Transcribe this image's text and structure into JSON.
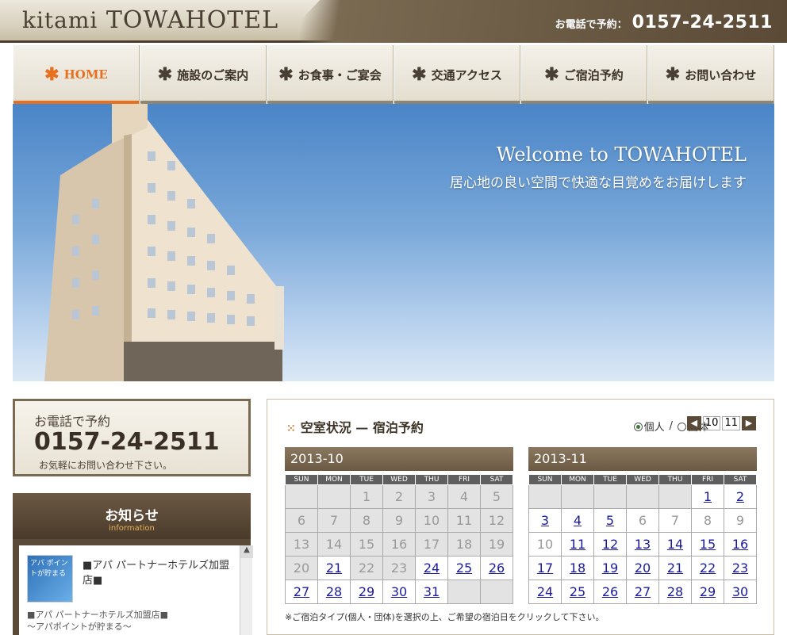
{
  "header": {
    "logo_small": "kitami",
    "logo_big": "TOWAHOTEL",
    "tel_label": "お電話で予約：",
    "tel_number": "0157-24-2511"
  },
  "nav": [
    {
      "label": "HOME",
      "active": true
    },
    {
      "label": "施設のご案内"
    },
    {
      "label": "お食事・ご宴会"
    },
    {
      "label": "交通アクセス"
    },
    {
      "label": "ご宿泊予約"
    },
    {
      "label": "お問い合わせ"
    }
  ],
  "hero": {
    "welcome": "Welcome to TOWAHOTEL",
    "tagline": "居心地の良い空間で快適な目覚めをお届けします"
  },
  "telbox": {
    "label": "お電話で予約",
    "number": "0157-24-2511",
    "note": "お気軽にお問い合わせ下さい。"
  },
  "news": {
    "heading": "お知らせ",
    "sub": "information",
    "image_text": "アパ ポイントが貯まる",
    "title": "■アパ パートナーホテルズ加盟店■",
    "line1": "■アパ パートナーホテルズ加盟店■",
    "line2": "～アパポイントが貯まる～"
  },
  "reservation": {
    "title": "空室状況 — 宿泊予約",
    "opt_individual": "個人",
    "opt_sep": "/",
    "opt_group": "団体",
    "month_a": "10",
    "month_b": "11",
    "weekdays": [
      "SUN",
      "MON",
      "TUE",
      "WED",
      "THU",
      "FRI",
      "SAT"
    ],
    "note": "※ご宿泊タイプ(個人・団体)を選択の上、ご希望の宿泊日をクリックして下さい。",
    "calendars": [
      {
        "title": "2013-10",
        "rows": [
          [
            "",
            "",
            "1",
            "2",
            "3",
            "4",
            "5"
          ],
          [
            "6",
            "7",
            "8",
            "9",
            "10",
            "11",
            "12"
          ],
          [
            "13",
            "14",
            "15",
            "16",
            "17",
            "18",
            "19"
          ],
          [
            "20",
            "21",
            "22",
            "23",
            "24",
            "25",
            "26"
          ],
          [
            "27",
            "28",
            "29",
            "30",
            "31",
            "",
            ""
          ]
        ],
        "available": [
          "21",
          "24",
          "25",
          "26",
          "27",
          "28",
          "29",
          "30",
          "31"
        ]
      },
      {
        "title": "2013-11",
        "rows": [
          [
            "",
            "",
            "",
            "",
            "",
            "1",
            "2"
          ],
          [
            "3",
            "4",
            "5",
            "6",
            "7",
            "8",
            "9"
          ],
          [
            "10",
            "11",
            "12",
            "13",
            "14",
            "15",
            "16"
          ],
          [
            "17",
            "18",
            "19",
            "20",
            "21",
            "22",
            "23"
          ],
          [
            "24",
            "25",
            "26",
            "27",
            "28",
            "29",
            "30"
          ]
        ],
        "available": [
          "1",
          "2",
          "3",
          "4",
          "5",
          "11",
          "12",
          "13",
          "14",
          "15",
          "16",
          "17",
          "18",
          "19",
          "20",
          "21",
          "22",
          "23",
          "24",
          "25",
          "26",
          "27",
          "28",
          "29",
          "30"
        ]
      }
    ]
  }
}
